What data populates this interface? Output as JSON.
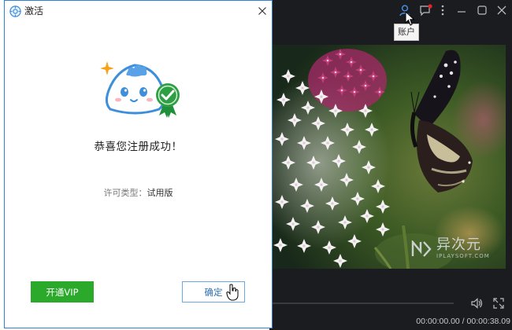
{
  "dialog": {
    "title": "激活",
    "success_message": "恭喜您注册成功！",
    "license_label": "许可类型：",
    "license_value": "试用版",
    "vip_button": "开通VIP",
    "ok_button": "确定"
  },
  "player": {
    "account_tooltip": "账户",
    "time": "00:00:00.00 / 00:00:38.09",
    "watermark_main": "异次元",
    "watermark_sub": "IPLAYSOFT.COM"
  },
  "colors": {
    "dialog_border": "#2f7fd6",
    "vip_green": "#2aa92a",
    "player_bg": "#1b1c1f",
    "notification_red": "#e0262b"
  },
  "icons": {
    "dialog": [
      "app-logo-icon",
      "close-icon",
      "mascot-icon",
      "verified-badge-icon"
    ],
    "player": [
      "account-icon",
      "message-icon",
      "more-icon",
      "minimize-icon",
      "maximize-icon",
      "close-icon",
      "volume-icon",
      "fullscreen-icon"
    ]
  }
}
